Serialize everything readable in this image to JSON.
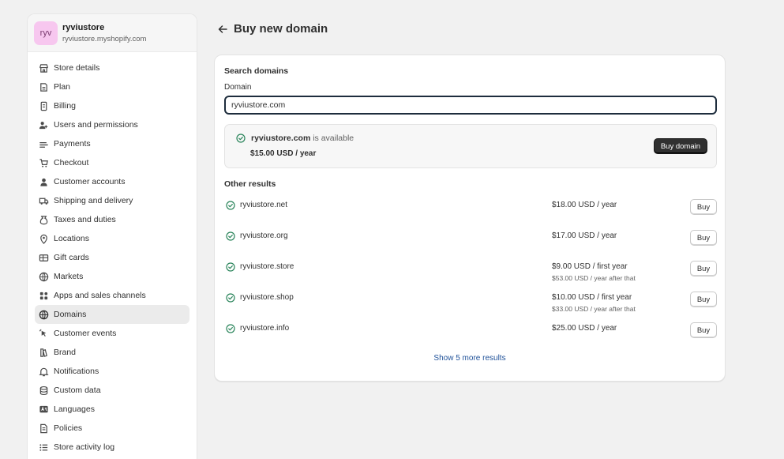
{
  "store": {
    "initials": "ryv",
    "name": "ryviustore",
    "url": "ryviustore.myshopify.com"
  },
  "nav": [
    {
      "label": "Store details",
      "icon": "store-icon"
    },
    {
      "label": "Plan",
      "icon": "plan-icon"
    },
    {
      "label": "Billing",
      "icon": "billing-icon"
    },
    {
      "label": "Users and permissions",
      "icon": "users-icon"
    },
    {
      "label": "Payments",
      "icon": "payments-icon"
    },
    {
      "label": "Checkout",
      "icon": "cart-icon"
    },
    {
      "label": "Customer accounts",
      "icon": "person-icon"
    },
    {
      "label": "Shipping and delivery",
      "icon": "truck-icon"
    },
    {
      "label": "Taxes and duties",
      "icon": "tax-icon"
    },
    {
      "label": "Locations",
      "icon": "location-icon"
    },
    {
      "label": "Gift cards",
      "icon": "gift-card-icon"
    },
    {
      "label": "Markets",
      "icon": "globe-icon"
    },
    {
      "label": "Apps and sales channels",
      "icon": "apps-icon"
    },
    {
      "label": "Domains",
      "icon": "domain-icon",
      "active": true
    },
    {
      "label": "Customer events",
      "icon": "cursor-icon"
    },
    {
      "label": "Brand",
      "icon": "brand-icon"
    },
    {
      "label": "Notifications",
      "icon": "bell-icon"
    },
    {
      "label": "Custom data",
      "icon": "data-icon"
    },
    {
      "label": "Languages",
      "icon": "language-icon"
    },
    {
      "label": "Policies",
      "icon": "policy-icon"
    },
    {
      "label": "Store activity log",
      "icon": "list-icon"
    }
  ],
  "page": {
    "title": "Buy new domain"
  },
  "search": {
    "section_title": "Search domains",
    "field_label": "Domain",
    "value": "ryviustore.com"
  },
  "available": {
    "domain": "ryviustore.com",
    "suffix": " is available",
    "price": "$15.00 USD / year",
    "button": "Buy domain"
  },
  "other": {
    "title": "Other results",
    "buy_label": "Buy",
    "results": [
      {
        "domain": "ryviustore.net",
        "price": "$18.00 USD / year",
        "sub": ""
      },
      {
        "domain": "ryviustore.org",
        "price": "$17.00 USD / year",
        "sub": ""
      },
      {
        "domain": "ryviustore.store",
        "price": "$9.00 USD / first year",
        "sub": "$53.00 USD / year after that"
      },
      {
        "domain": "ryviustore.shop",
        "price": "$10.00 USD / first year",
        "sub": "$33.00 USD / year after that"
      },
      {
        "domain": "ryviustore.info",
        "price": "$25.00 USD / year",
        "sub": ""
      }
    ],
    "show_more": "Show 5 more results"
  },
  "colors": {
    "check": "#29845a",
    "link": "#1f5199",
    "primary": "#303030"
  }
}
